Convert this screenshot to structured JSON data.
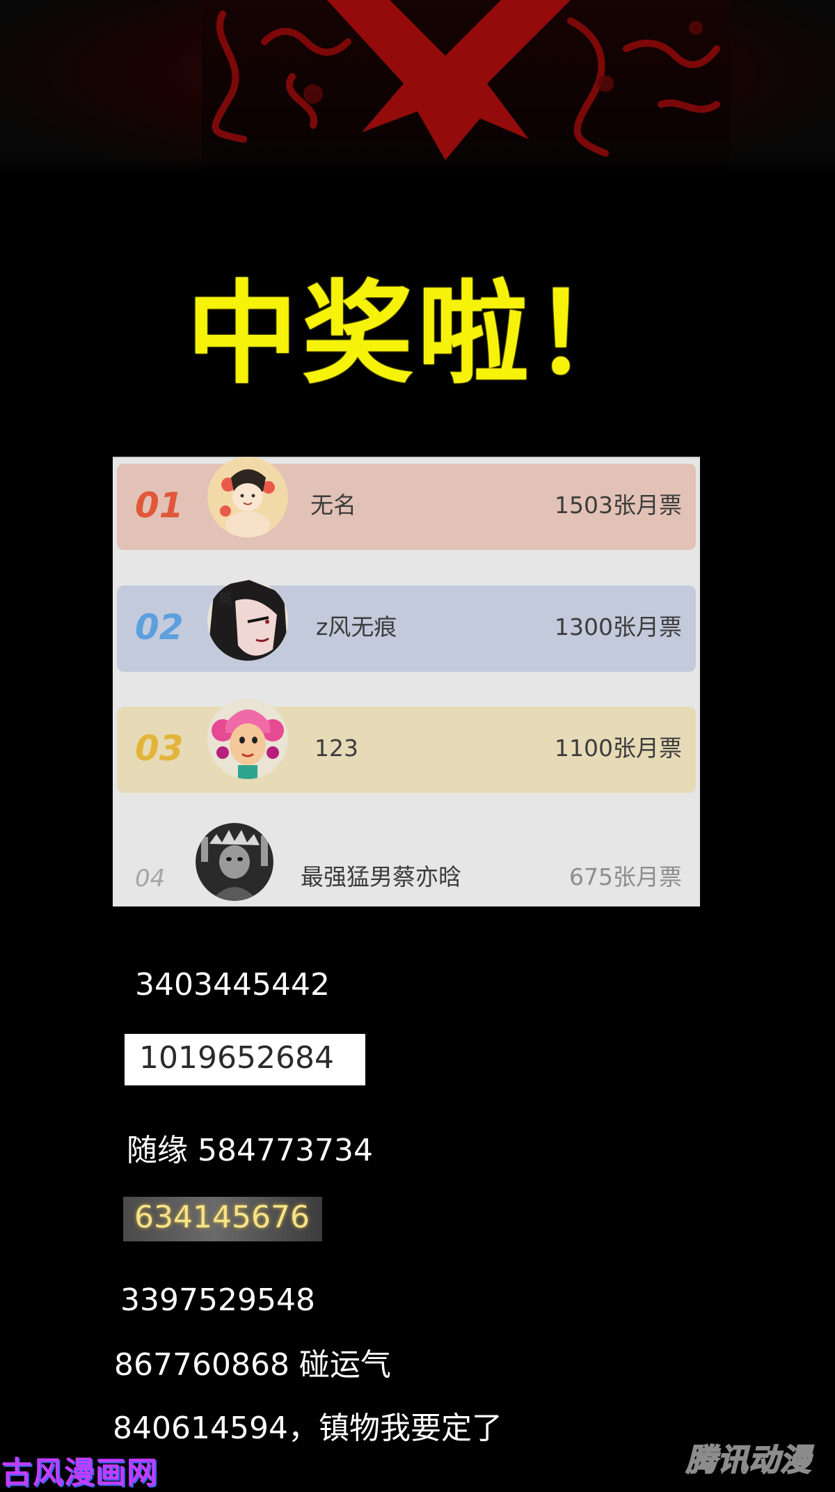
{
  "headline": "中奖啦！",
  "ranking": [
    {
      "rank": "01",
      "name": "无名",
      "votes": "1503张月票"
    },
    {
      "rank": "02",
      "name": "z风无痕",
      "votes": "1300张月票"
    },
    {
      "rank": "03",
      "name": "123",
      "votes": "1100张月票"
    },
    {
      "rank": "04",
      "name": "最强猛男蔡亦晗",
      "votes": "675张月票"
    }
  ],
  "winners": [
    "3403445442",
    "1019652684",
    "随缘 584773734",
    "634145676",
    "3397529548",
    "867760868 碰运气",
    "840614594，镇物我要定了"
  ],
  "watermarks": {
    "left": "古风漫画网",
    "right": "腾讯动漫"
  },
  "colors": {
    "headline": "#f6f20a",
    "rank1": "#e0573a",
    "rank2": "#5b9fde",
    "rank3": "#e2b53a",
    "rank4": "#a5a5a5"
  },
  "icons": {
    "avatar1": "girl-avatar-icon",
    "avatar2": "warrior-avatar-icon",
    "avatar3": "cartoon-girl-avatar-icon",
    "avatar4": "monochrome-avatar-icon"
  }
}
